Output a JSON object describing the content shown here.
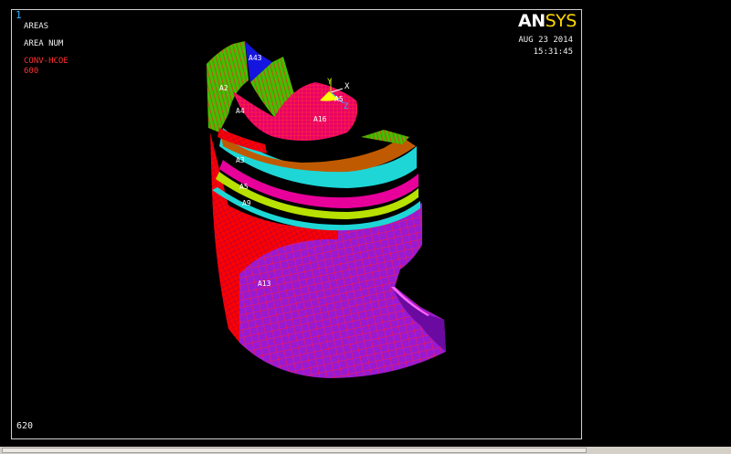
{
  "window": {
    "number": "1"
  },
  "legend": {
    "line1": "AREAS",
    "line2": "AREA NUM",
    "line3": "CONV-HCOE",
    "line4": "600"
  },
  "logo": {
    "part1": "AN",
    "part2": "SYS"
  },
  "timestamp": {
    "date": "AUG 23 2014",
    "time": "15:31:45"
  },
  "footer": {
    "value": "620"
  },
  "triad": {
    "x": "X",
    "y": "Y",
    "z": "Z"
  },
  "area_labels": {
    "a43": "A43",
    "a2": "A2",
    "a4": "A4",
    "a16": "A16",
    "a3": "A3",
    "a5": "A5",
    "a9": "A9",
    "a13": "A13",
    "a15": "A5"
  },
  "colors": {
    "background": "#000000",
    "mesh_red": "#ff0000",
    "cyan": "#1ed6d6",
    "magenta": "#e8009a",
    "green": "#3fc000",
    "purple": "#9a1ad2",
    "blue": "#1515e0",
    "logo_yellow": "#ffd700"
  }
}
